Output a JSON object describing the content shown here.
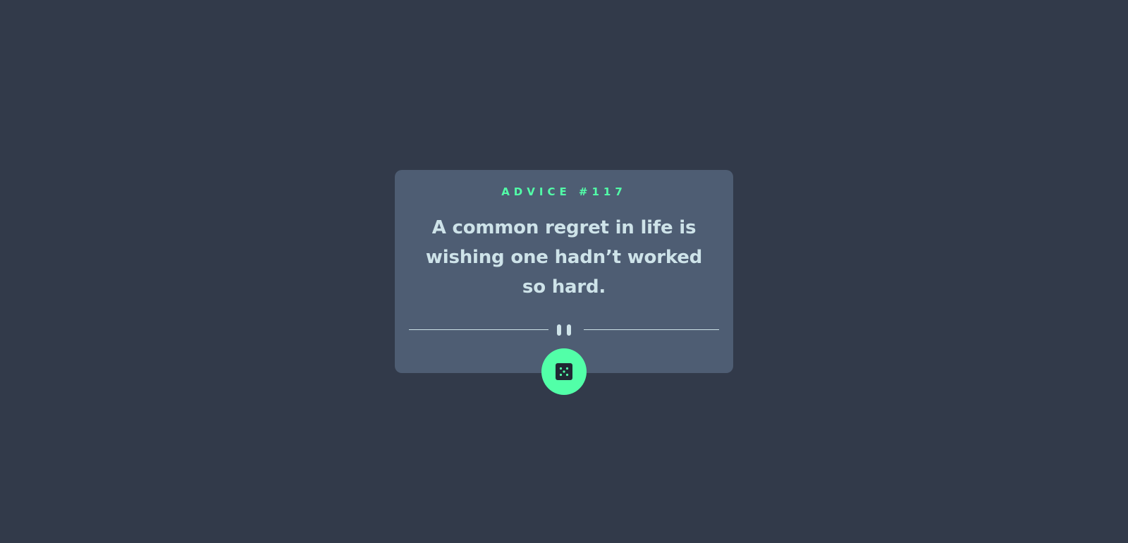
{
  "card": {
    "label": "ADVICE #117",
    "quote": "A common regret in life is wishing one hadn’t worked so hard."
  },
  "icons": {
    "divider": "pause-icon",
    "button": "dice-icon"
  },
  "colors": {
    "background": "#323a4a",
    "card": "#4e5d73",
    "accent": "#52ffa8",
    "text": "#cee3e9"
  }
}
